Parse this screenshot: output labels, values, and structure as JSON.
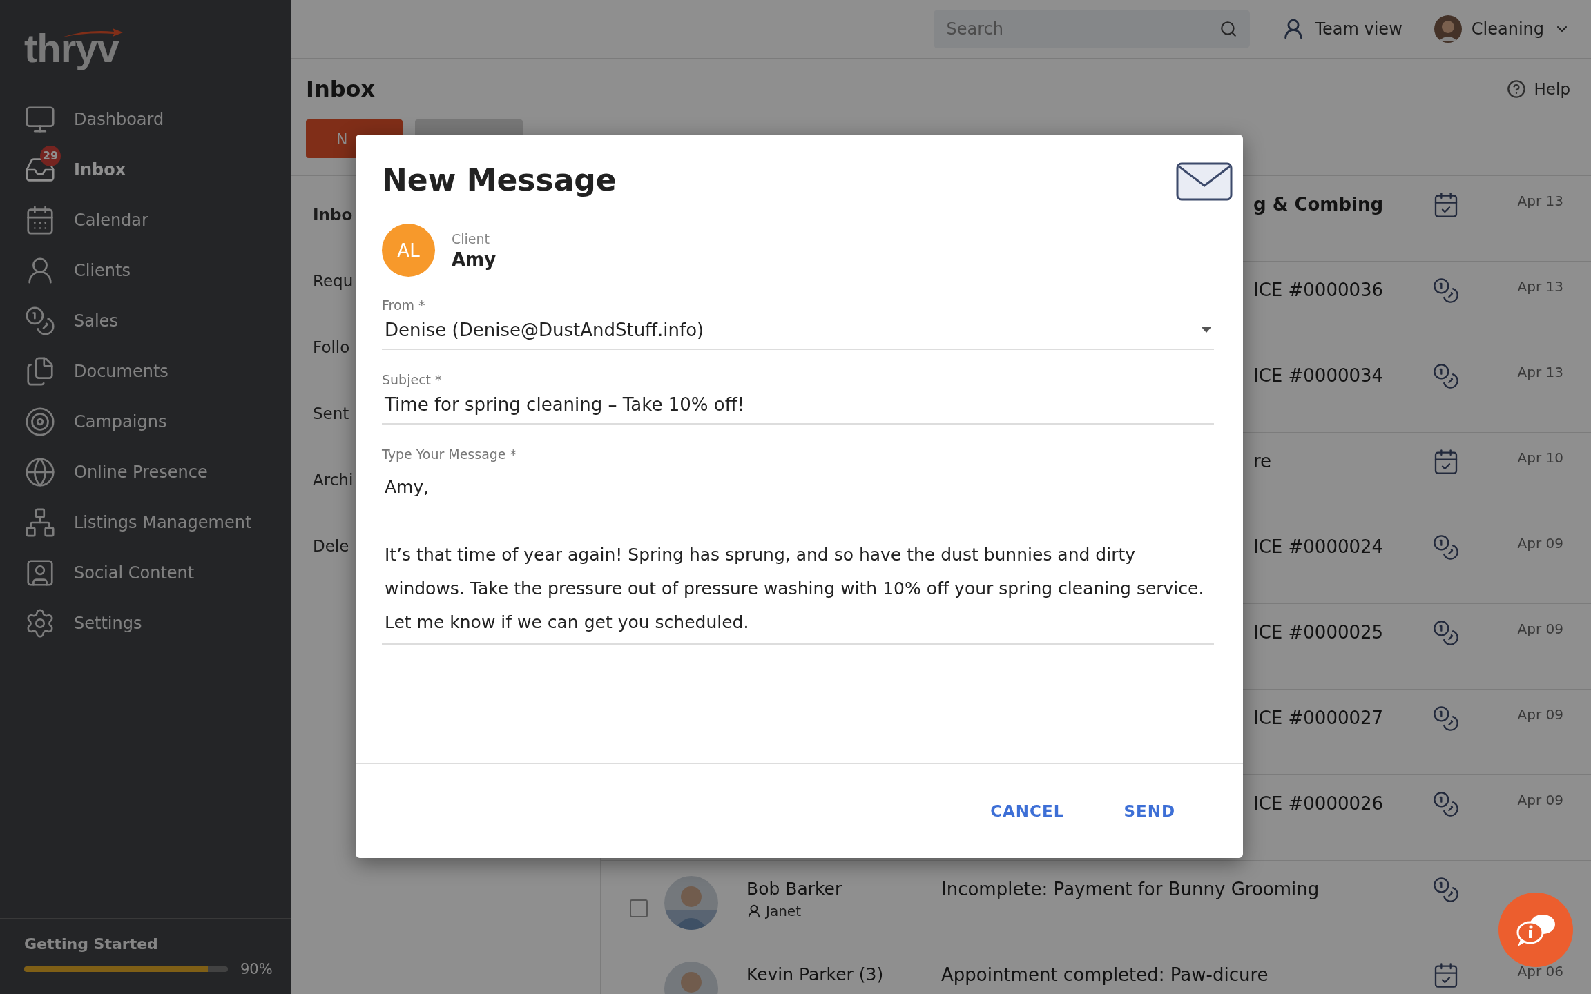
{
  "sidebar": {
    "logo": "thryv",
    "items": [
      {
        "label": "Dashboard",
        "selected": false
      },
      {
        "label": "Inbox",
        "badge": "29",
        "selected": true
      },
      {
        "label": "Calendar",
        "selected": false
      },
      {
        "label": "Clients",
        "selected": false
      },
      {
        "label": "Sales",
        "selected": false
      },
      {
        "label": "Documents",
        "selected": false
      },
      {
        "label": "Campaigns",
        "selected": false
      },
      {
        "label": "Online Presence",
        "selected": false
      },
      {
        "label": "Listings Management",
        "selected": false
      },
      {
        "label": "Social Content",
        "selected": false
      },
      {
        "label": "Settings",
        "selected": false
      }
    ],
    "getting_started": {
      "label": "Getting Started",
      "level": 0.9,
      "reading": "90%"
    }
  },
  "topbar": {
    "search": {
      "placeholder": "Search"
    },
    "team_view": "Team view",
    "account": "Cleaning"
  },
  "header": {
    "title": "Inbox",
    "help": "Help",
    "buttons": [
      {
        "label": "N",
        "kind": "primary"
      },
      {
        "kind": "secondary"
      }
    ]
  },
  "folders": [
    {
      "label": "Inbo",
      "selected": true
    },
    {
      "label": "Requ",
      "selected": false
    },
    {
      "label": "Follo",
      "selected": false
    },
    {
      "label": "Sent",
      "selected": false
    },
    {
      "label": "Archi",
      "selected": false
    },
    {
      "label": "Dele",
      "selected": false
    }
  ],
  "messages": [
    {
      "subject": "g & Combing",
      "kind": "appointment",
      "date": "Apr 13",
      "unread": true
    },
    {
      "subject": "ICE #0000036",
      "kind": "invoice",
      "date": "Apr 13",
      "unread": false
    },
    {
      "subject": "ICE #0000034",
      "kind": "invoice",
      "date": "Apr 13",
      "unread": false
    },
    {
      "subject": "re",
      "kind": "appointment",
      "date": "Apr 10",
      "unread": false
    },
    {
      "subject": "ICE #0000024",
      "kind": "invoice",
      "date": "Apr 09",
      "unread": false
    },
    {
      "subject": "ICE #0000025",
      "kind": "invoice",
      "date": "Apr 09",
      "unread": false
    },
    {
      "subject": "ICE #0000027",
      "kind": "invoice",
      "date": "Apr 09",
      "unread": false
    },
    {
      "subject": "ICE #0000026",
      "kind": "invoice",
      "date": "Apr 09",
      "unread": false
    },
    {
      "sender": "Bob Barker",
      "staff": "Janet",
      "subject": "Incomplete: Payment for Bunny Grooming",
      "kind": "invoice",
      "unread": false,
      "checked": false
    },
    {
      "sender": "Kevin Parker (3)",
      "subject": "Appointment completed: Paw-dicure",
      "kind": "appointment",
      "date": "Apr 06",
      "unread": false
    }
  ],
  "dialog": {
    "title": "New Message",
    "client": {
      "initials": "AL",
      "label": "Client",
      "name": "Amy"
    },
    "from": {
      "label": "From *",
      "value": "Denise (Denise@DustAndStuff.info)"
    },
    "subject": {
      "label": "Subject *",
      "value": "Time for spring cleaning – Take 10% off!"
    },
    "message": {
      "label": "Type Your Message *",
      "value": "Amy,\n\nIt’s that time of year again! Spring has sprung, and so have the dust bunnies and dirty windows. Take the pressure out of pressure washing with 10% off your spring cleaning service. Let me know if we can get you scheduled."
    },
    "buttons": [
      "CANCEL",
      "SEND"
    ]
  }
}
